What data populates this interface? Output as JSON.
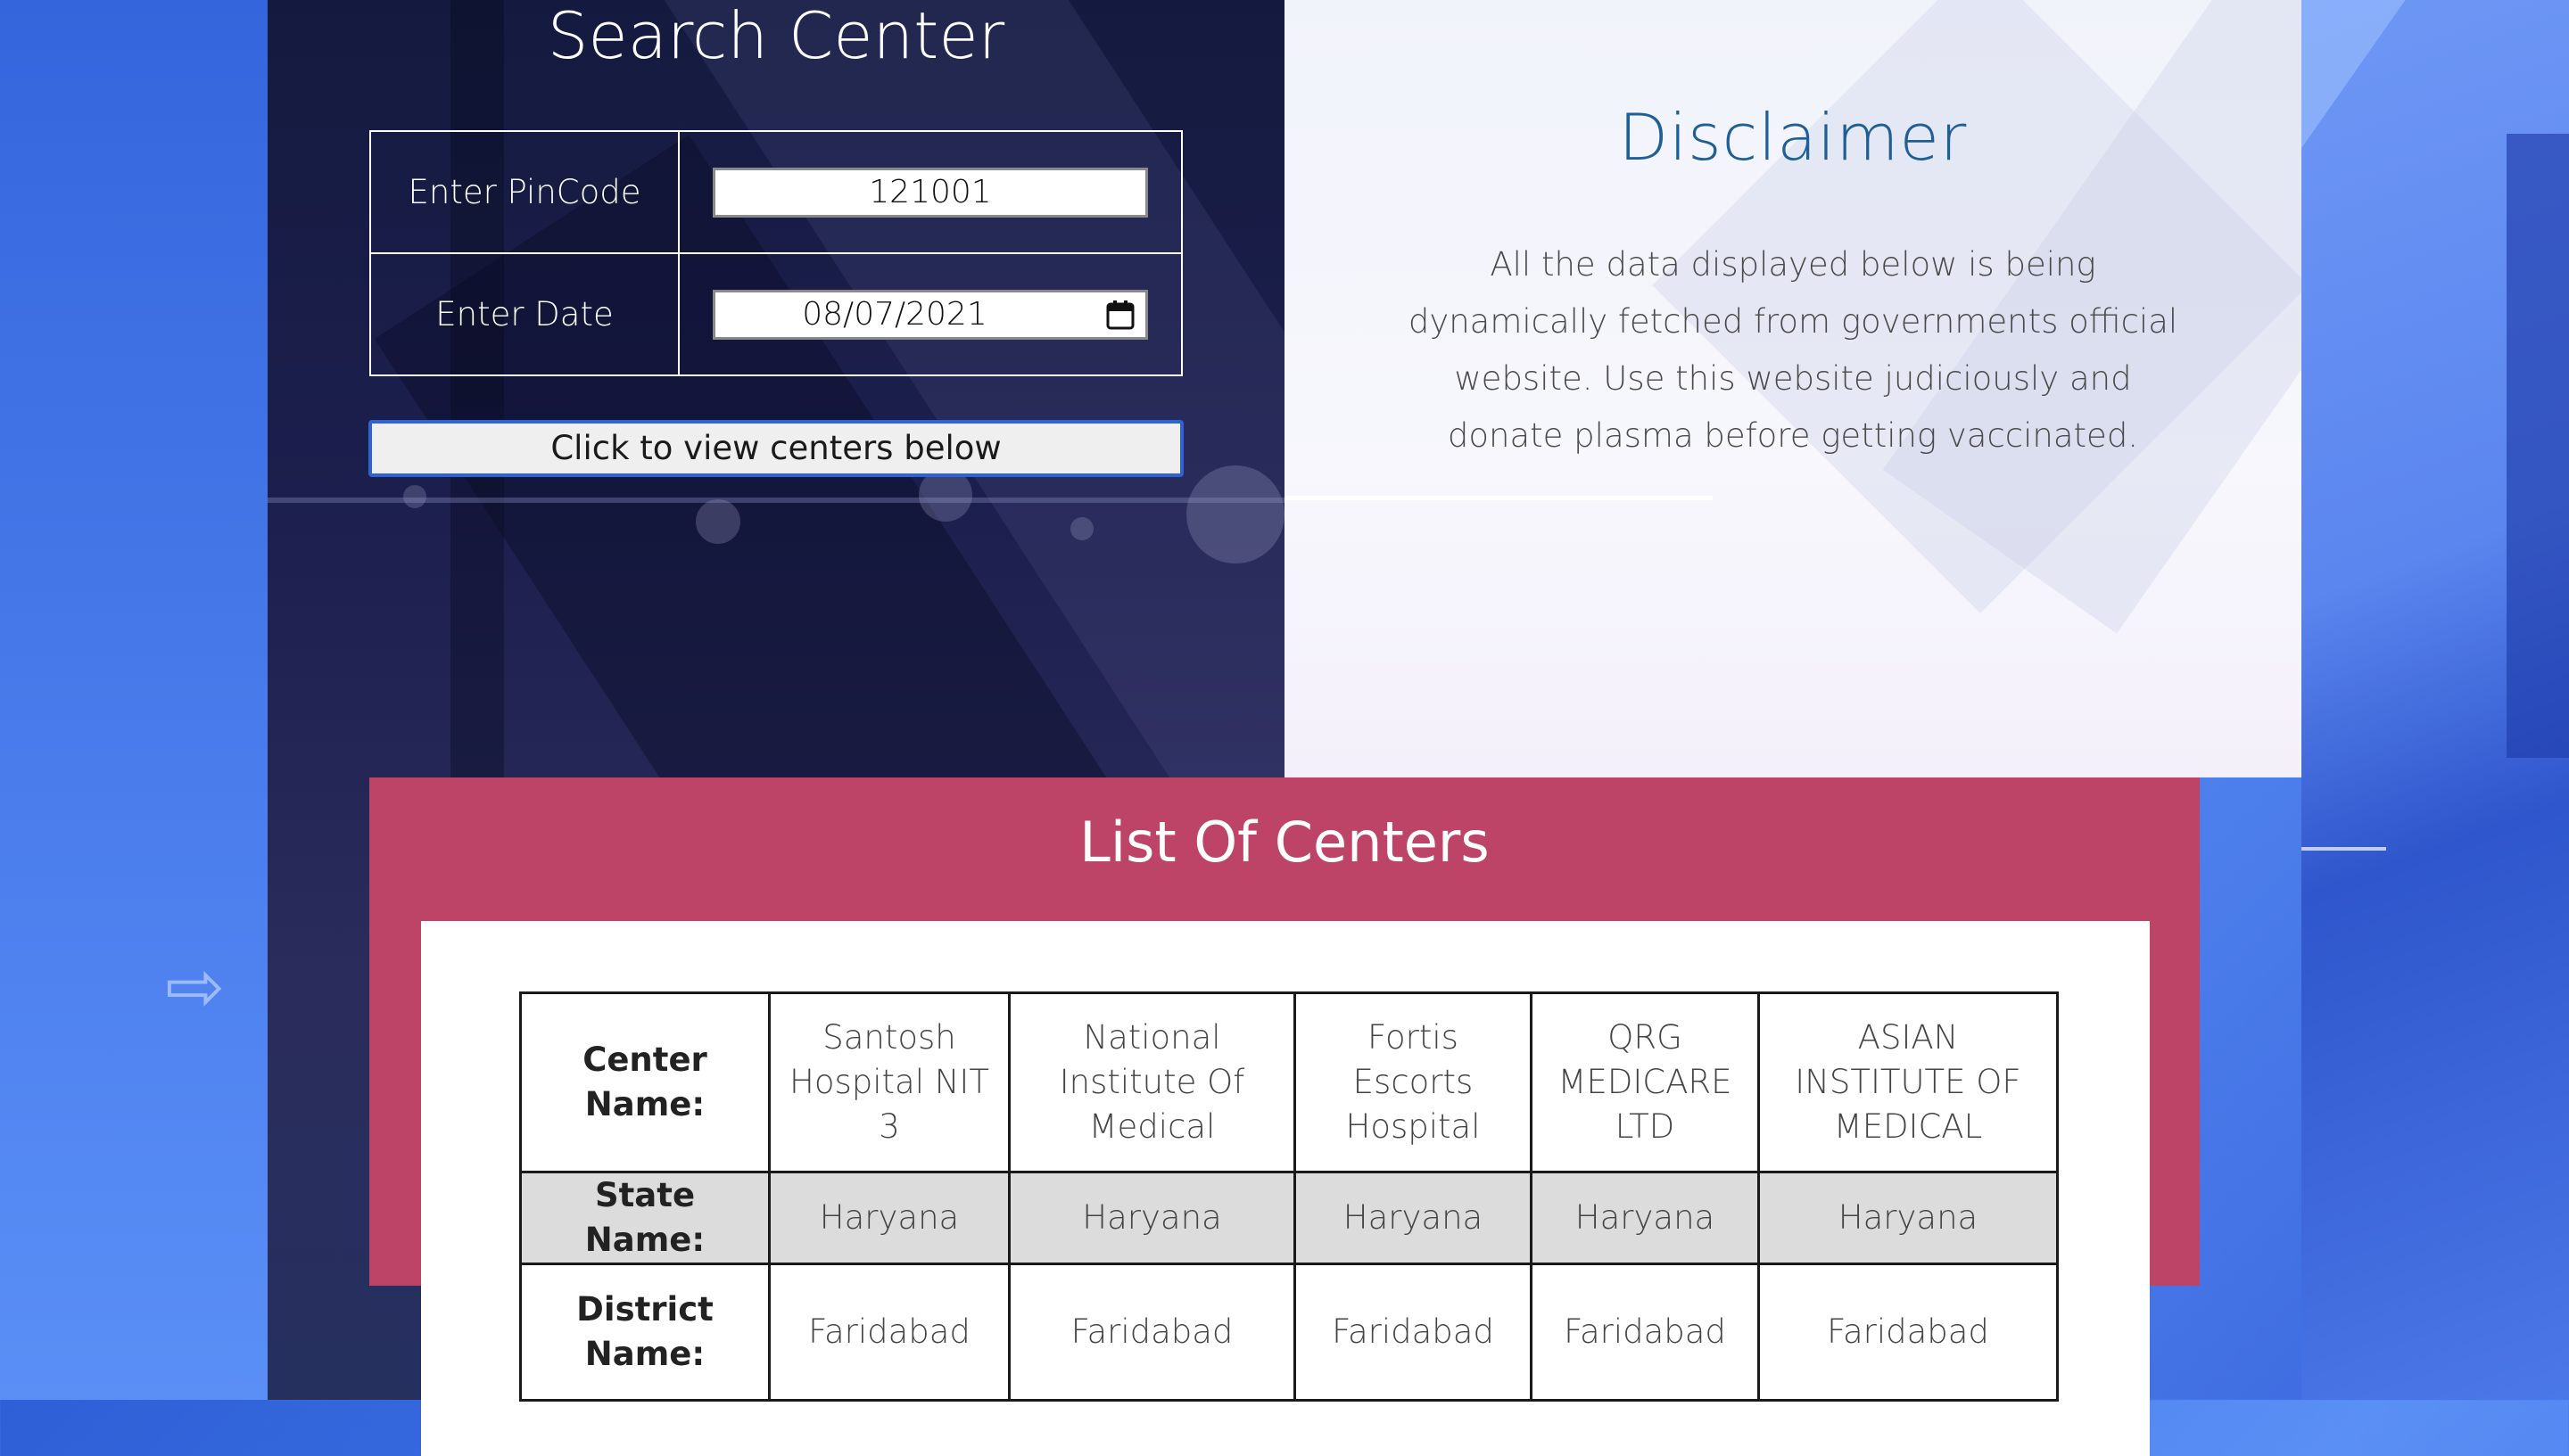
{
  "search": {
    "title": "Search Center",
    "pincode_label": "Enter PinCode",
    "pincode_value": "121001",
    "date_label": "Enter Date",
    "date_value": "08/07/2021",
    "button_label": "Click to view centers below"
  },
  "disclaimer": {
    "title": "Disclaimer",
    "text": "All the data displayed below is being dynamically fetched from governments official website. Use this website judiciously and donate plasma before getting vaccinated."
  },
  "centers": {
    "title": "List Of Centers",
    "rows": [
      {
        "label": "Center Name:",
        "values": [
          "Santosh Hospital NIT 3",
          "National Institute Of Medical",
          "Fortis Escorts Hospital",
          "QRG MEDICARE LTD",
          "ASIAN INSTITUTE OF MEDICAL"
        ]
      },
      {
        "label": "State Name:",
        "values": [
          "Haryana",
          "Haryana",
          "Haryana",
          "Haryana",
          "Haryana"
        ]
      },
      {
        "label": "District Name:",
        "values": [
          "Faridabad",
          "Faridabad",
          "Faridabad",
          "Faridabad",
          "Faridabad"
        ]
      }
    ]
  },
  "colors": {
    "banner": "#bd4467",
    "disclaimer_title": "#1f5f97",
    "button_border": "#2d63d6"
  }
}
